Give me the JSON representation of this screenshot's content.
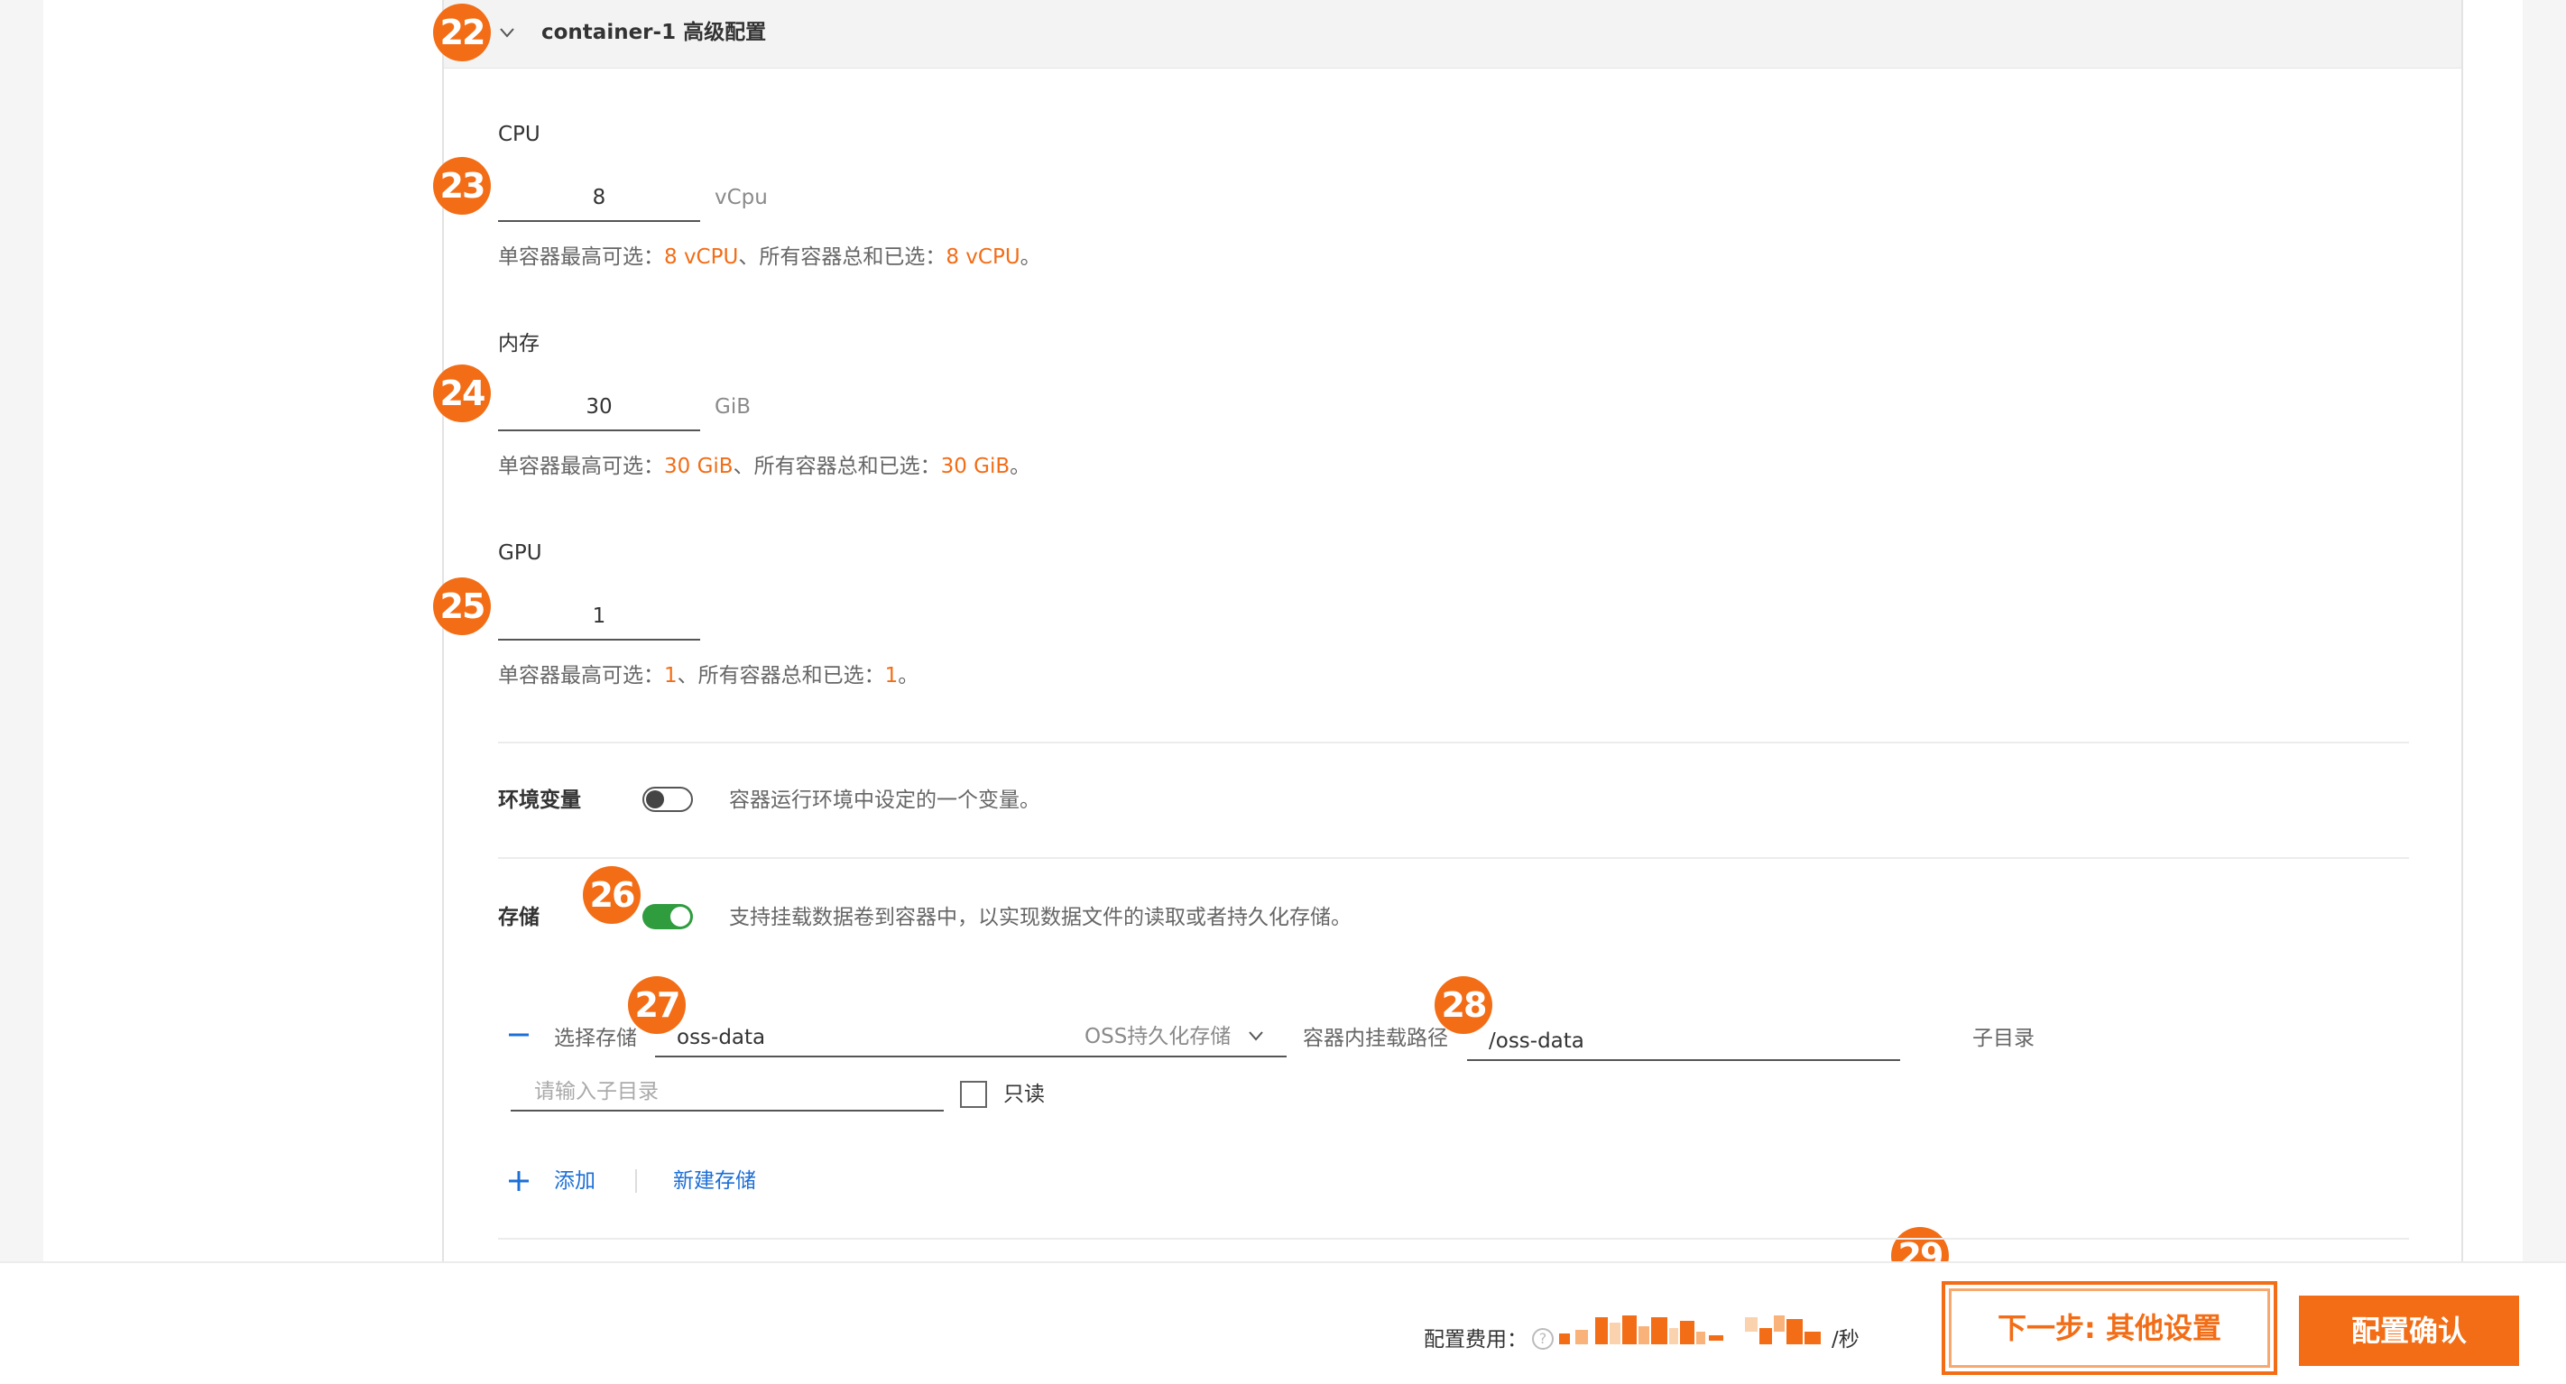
{
  "header": {
    "title": "container-1 高级配置",
    "chevron_icon": "chevron-down-icon"
  },
  "badges": [
    "22",
    "23",
    "24",
    "25",
    "26",
    "27",
    "28",
    "29"
  ],
  "cpu": {
    "label": "CPU",
    "value": "8",
    "unit": "vCpu",
    "hint_prefix": "单容器最高可选：",
    "hint_v1": "8 vCPU",
    "hint_mid": "、所有容器总和已选：",
    "hint_v2": "8 vCPU",
    "hint_end": "。"
  },
  "memory": {
    "label": "内存",
    "value": "30",
    "unit": "GiB",
    "hint_prefix": "单容器最高可选：",
    "hint_v1": "30 GiB",
    "hint_mid": "、所有容器总和已选：",
    "hint_v2": "30 GiB",
    "hint_end": "。"
  },
  "gpu": {
    "label": "GPU",
    "value": "1",
    "hint_prefix": "单容器最高可选：",
    "hint_v1": "1",
    "hint_mid": "、所有容器总和已选：",
    "hint_v2": "1",
    "hint_end": "。"
  },
  "env": {
    "label": "环境变量",
    "enabled": false,
    "desc": "容器运行环境中设定的一个变量。"
  },
  "storage": {
    "label": "存储",
    "enabled": true,
    "desc": "支持挂载数据卷到容器中，以实现数据文件的读取或者持久化存储。",
    "row": {
      "select_label": "选择存储",
      "select_value": "oss-data",
      "storage_type": "OSS持久化存储",
      "mount_label": "容器内挂载路径",
      "mount_value": "/oss-data",
      "subdir_label": "子目录",
      "subdir_placeholder": "请输入子目录",
      "readonly_label": "只读"
    },
    "add_label": "添加",
    "new_label": "新建存储"
  },
  "footer": {
    "fee_label": "配置费用：",
    "fee_unit": "/秒",
    "next_button": "下一步: 其他设置",
    "confirm_button": "配置确认"
  },
  "colors": {
    "accent": "#f26d16",
    "toggle_on": "#2f9c3e",
    "link": "#1d6fd6"
  }
}
